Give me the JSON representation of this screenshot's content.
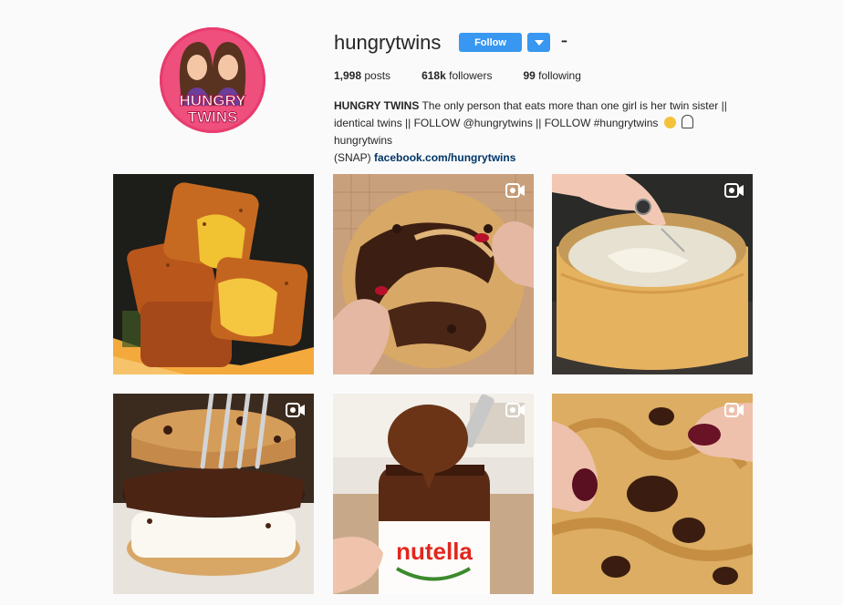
{
  "profile": {
    "username": "hungrytwins",
    "avatar_text_line1": "HUNGRY",
    "avatar_text_line2": "TWINS",
    "follow_label": "Follow",
    "more_label": "•••",
    "stats": {
      "posts_count": "1,998",
      "posts_label": "posts",
      "followers_count": "618k",
      "followers_label": "followers",
      "following_count": "99",
      "following_label": "following"
    },
    "bio": {
      "name": "HUNGRY TWINS",
      "line1": "The only person that eats more than one girl is her twin sister ||",
      "line2": "identical twins || FOLLOW @hungrytwins || FOLLOW #hungrytwins",
      "snap_handle": "hungrytwins",
      "line3": "(SNAP)",
      "link": "facebook.com/hungrytwins"
    }
  },
  "posts": [
    {
      "subject": "mac and cheese bites",
      "is_video": false
    },
    {
      "subject": "chocolate swirl cookie",
      "is_video": true
    },
    {
      "subject": "parmesan wheel pasta",
      "is_video": true
    },
    {
      "subject": "cookie ice cream sandwich",
      "is_video": true
    },
    {
      "subject": "nutella jar",
      "is_video": true,
      "jar_label": "nutella"
    },
    {
      "subject": "chocolate chip cookie",
      "is_video": true
    }
  ],
  "colors": {
    "accent": "#3897f0",
    "link": "#003569",
    "avatar_bg": "#e83b6e"
  }
}
